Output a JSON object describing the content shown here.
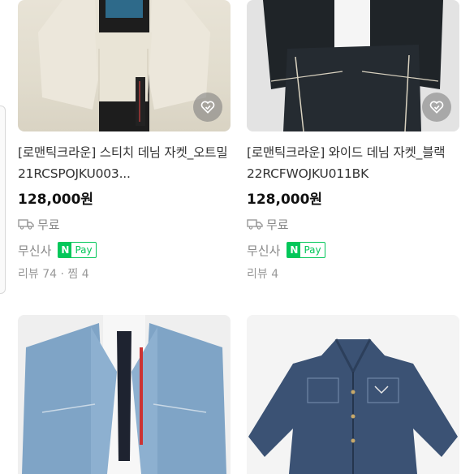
{
  "products": [
    {
      "title": "[로맨틱크라운] 스티치 데님 자켓_오트밀 21RCSPOJKU003...",
      "price": "128,000원",
      "shipping": "무료",
      "seller": "무신사",
      "npay": {
        "n": "N",
        "pay": "Pay"
      },
      "meta": "리뷰 74 · 찜 4"
    },
    {
      "title": "[로맨틱크라운] 와이드 데님 자켓_블랙 22RCFWOJKU011BK",
      "price": "128,000원",
      "shipping": "무료",
      "seller": "무신사",
      "npay": {
        "n": "N",
        "pay": "Pay"
      },
      "meta": "리뷰 4"
    }
  ],
  "colors": {
    "npay_green": "#03c75a",
    "price": "#111111",
    "muted": "#888888"
  },
  "icons": [
    "wishlist-heart-icon",
    "delivery-truck-icon"
  ]
}
